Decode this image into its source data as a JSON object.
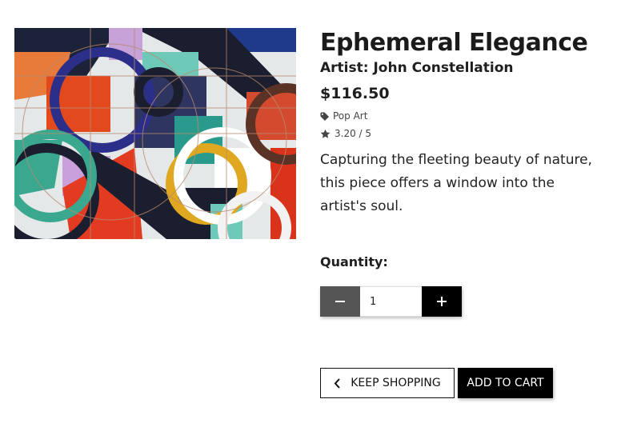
{
  "product": {
    "title": "Ephemeral Elegance",
    "artist": "Artist: John Constellation",
    "price": "$116.50",
    "category": "Pop Art",
    "rating": "3.20 / 5",
    "description": "Capturing the fleeting beauty of nature, this piece offers a window into the artist's soul.",
    "image_icon": "abstract-geometric-artwork"
  },
  "quantity": {
    "label": "Quantity:",
    "value": "1",
    "minus_icon": "minus-icon",
    "plus_icon": "plus-icon"
  },
  "actions": {
    "keep_shopping": "KEEP SHOPPING",
    "add_to_cart": "ADD TO CART"
  },
  "colors": {
    "button_dark": "#000000",
    "button_minus": "#555555",
    "text": "#1f1f1f"
  }
}
